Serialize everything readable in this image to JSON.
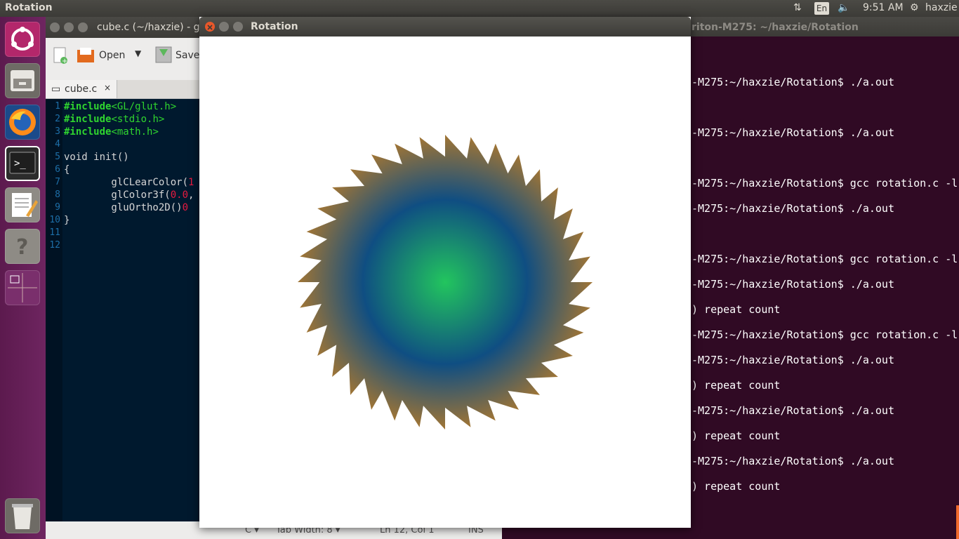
{
  "topbar": {
    "app_title": "Rotation",
    "keyboard": "En",
    "time": "9:51 AM",
    "user": "haxzie"
  },
  "launcher": {
    "items": [
      "ubuntu-dash",
      "files",
      "firefox",
      "terminal",
      "text-editor",
      "help",
      "workspace-switcher",
      "trash"
    ]
  },
  "gedit": {
    "title": "cube.c (~/haxzie) - ge",
    "open_label": "Open",
    "save_label": "Save",
    "tab_label": "cube.c",
    "close_tab": "×",
    "lines": [
      {
        "n": "1",
        "parts": [
          [
            "kw",
            "#include"
          ],
          [
            "str",
            "<GL/glut.h>"
          ]
        ]
      },
      {
        "n": "2",
        "parts": [
          [
            "kw",
            "#include"
          ],
          [
            "str",
            "<stdio.h>"
          ]
        ]
      },
      {
        "n": "3",
        "parts": [
          [
            "kw",
            "#include"
          ],
          [
            "str",
            "<math.h>"
          ]
        ]
      },
      {
        "n": "4",
        "parts": []
      },
      {
        "n": "5",
        "parts": [
          [
            "pl",
            "void init()"
          ]
        ]
      },
      {
        "n": "6",
        "parts": [
          [
            "pl",
            "{"
          ]
        ]
      },
      {
        "n": "7",
        "parts": [
          [
            "pl",
            "        glCLearColor("
          ],
          [
            "num",
            "1"
          ]
        ]
      },
      {
        "n": "8",
        "parts": [
          [
            "pl",
            "        glColor3f("
          ],
          [
            "num",
            "0.0"
          ],
          [
            "pl",
            ","
          ]
        ]
      },
      {
        "n": "9",
        "parts": [
          [
            "pl",
            "        gluOrtho2D()"
          ],
          [
            "num",
            "0"
          ]
        ]
      },
      {
        "n": "10",
        "parts": [
          [
            "pl",
            "}"
          ]
        ]
      },
      {
        "n": "11",
        "parts": []
      },
      {
        "n": "12",
        "parts": []
      }
    ],
    "status": {
      "lang": "C",
      "tab_width": "Tab Width: 8",
      "position": "Ln 12, Col 1",
      "mode": "INS"
    }
  },
  "terminal": {
    "title": "riton-M275: ~/haxzie/Rotation",
    "lines": [
      {
        "y": 0,
        "text": ""
      },
      {
        "y": 1,
        "text": "-M275:~/haxzie/Rotation$ ./a.out"
      },
      {
        "y": 2,
        "text": "-M275:~/haxzie/Rotation$ ./a.out"
      },
      {
        "y": 3,
        "text": "-M275:~/haxzie/Rotation$ gcc rotation.c -l"
      },
      {
        "y": 4,
        "text": "-M275:~/haxzie/Rotation$ ./a.out"
      },
      {
        "y": 5,
        "text": "-M275:~/haxzie/Rotation$ gcc rotation.c -l"
      },
      {
        "y": 6,
        "text": "-M275:~/haxzie/Rotation$ ./a.out"
      },
      {
        "y": 7,
        "text": ") repeat count"
      },
      {
        "y": 8,
        "text": "-M275:~/haxzie/Rotation$ gcc rotation.c -l"
      },
      {
        "y": 9,
        "text": "-M275:~/haxzie/Rotation$ ./a.out"
      },
      {
        "y": 10,
        "text": ") repeat count"
      },
      {
        "y": 11,
        "text": "-M275:~/haxzie/Rotation$ ./a.out"
      },
      {
        "y": 12,
        "text": ") repeat count"
      },
      {
        "y": 13,
        "text": "-M275:~/haxzie/Rotation$ ./a.out"
      },
      {
        "y": 14,
        "text": ") repeat count"
      }
    ]
  },
  "rotation_window": {
    "title": "Rotation",
    "colors": {
      "outer": "#f08a0a",
      "inner": "#1aa060",
      "center": "#22c55e",
      "dark": "#0f4e82"
    }
  }
}
